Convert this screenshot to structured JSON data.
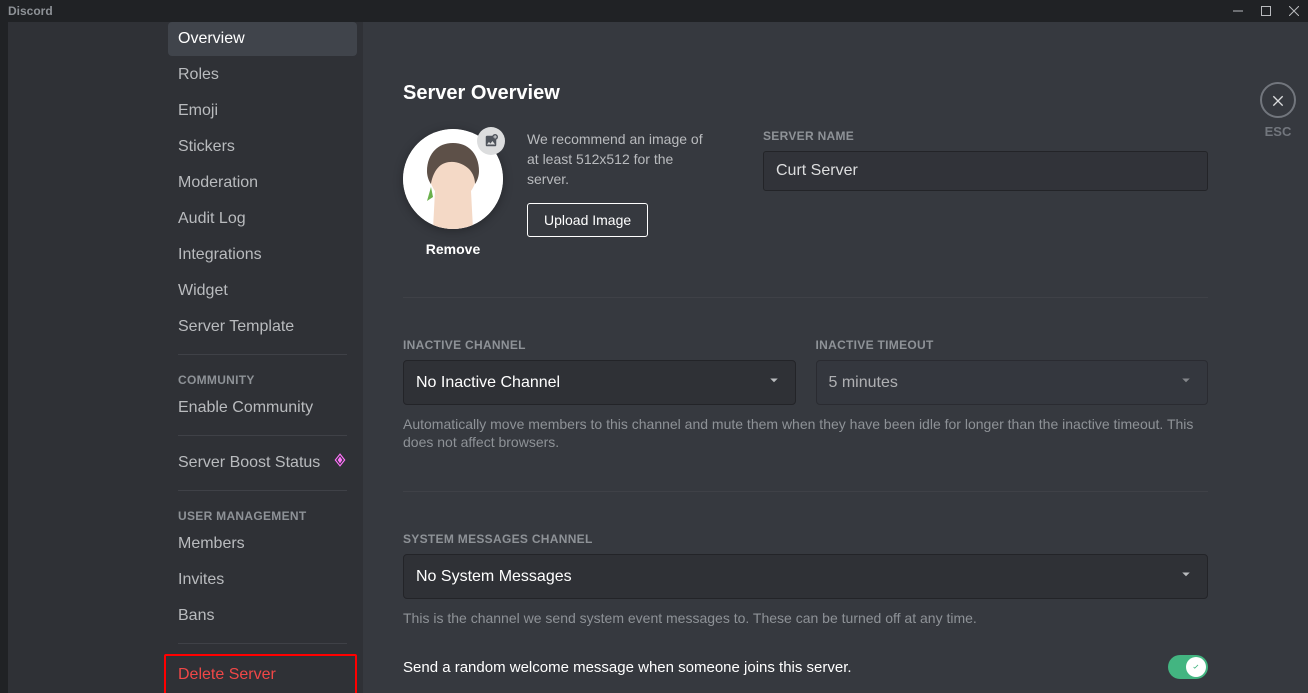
{
  "window": {
    "title": "Discord"
  },
  "sidebar": {
    "items": [
      {
        "label": "Overview",
        "selected": true
      },
      {
        "label": "Roles"
      },
      {
        "label": "Emoji"
      },
      {
        "label": "Stickers"
      },
      {
        "label": "Moderation"
      },
      {
        "label": "Audit Log"
      },
      {
        "label": "Integrations"
      },
      {
        "label": "Widget"
      },
      {
        "label": "Server Template"
      }
    ],
    "community_header": "COMMUNITY",
    "community_items": [
      {
        "label": "Enable Community"
      }
    ],
    "boost_label": "Server Boost Status",
    "user_mgmt_header": "USER MANAGEMENT",
    "user_mgmt_items": [
      {
        "label": "Members"
      },
      {
        "label": "Invites"
      },
      {
        "label": "Bans"
      }
    ],
    "delete_label": "Delete Server"
  },
  "content": {
    "page_title": "Server Overview",
    "avatar_help": "We recommend an image of at least 512x512 for the server.",
    "upload_button": "Upload Image",
    "remove_label": "Remove",
    "server_name_label": "SERVER NAME",
    "server_name_value": "Curt Server",
    "inactive_channel_label": "INACTIVE CHANNEL",
    "inactive_channel_value": "No Inactive Channel",
    "inactive_timeout_label": "INACTIVE TIMEOUT",
    "inactive_timeout_value": "5 minutes",
    "inactive_help": "Automatically move members to this channel and mute them when they have been idle for longer than the inactive timeout. This does not affect browsers.",
    "system_channel_label": "SYSTEM MESSAGES CHANNEL",
    "system_channel_value": "No System Messages",
    "system_help": "This is the channel we send system event messages to. These can be turned off at any time.",
    "welcome_toggle_label": "Send a random welcome message when someone joins this server.",
    "esc_label": "ESC"
  }
}
